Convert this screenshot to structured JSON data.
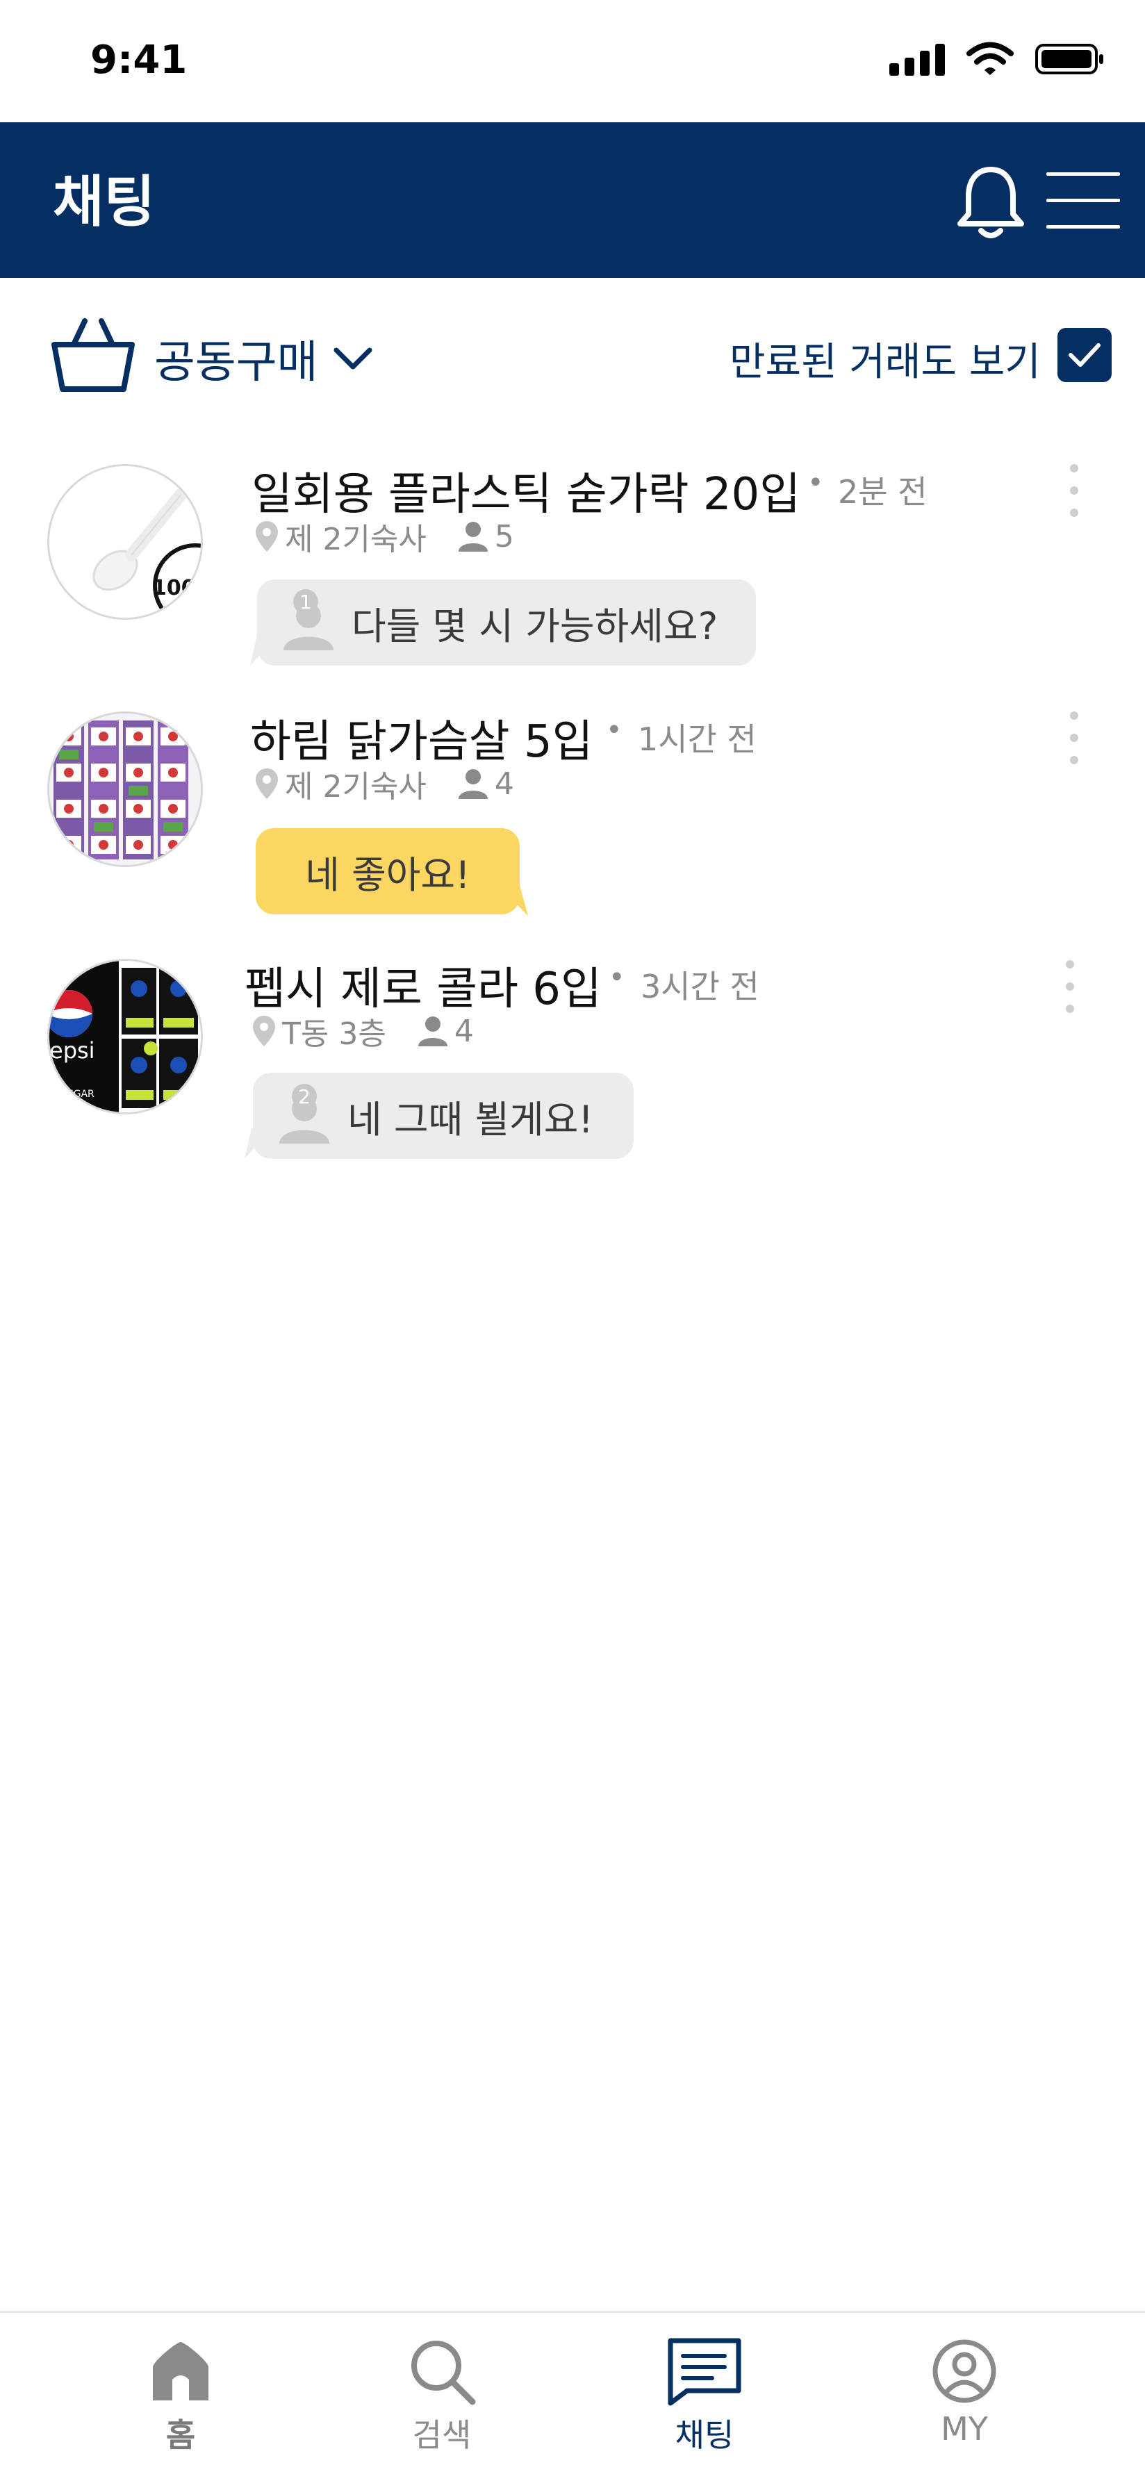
{
  "status_bar": {
    "time": "9:41"
  },
  "header": {
    "title": "채팅"
  },
  "filter": {
    "category": "공동구매",
    "show_expired_label": "만료된 거래도 보기",
    "show_expired_checked": true
  },
  "chats": [
    {
      "title": "일회용 플라스틱 숟가락 20입",
      "time": "2분 전",
      "location": "제 2기숙사",
      "members": "5",
      "message": "다들 몇 시 가능하세요?",
      "sender_badge": "1",
      "bubble": "gray"
    },
    {
      "title": "하림 닭가슴살 5입",
      "time": "1시간 전",
      "location": "제 2기숙사",
      "members": "4",
      "message": "네 좋아요!",
      "bubble": "yellow"
    },
    {
      "title": "펩시 제로 콜라 6입",
      "time": "3시간 전",
      "location": "T동 3층",
      "members": "4",
      "message": "네 그때 뵐게요!",
      "sender_badge": "2",
      "bubble": "gray"
    }
  ],
  "bottom_nav": [
    {
      "label": "홈",
      "icon": "home-icon",
      "active": false
    },
    {
      "label": "검색",
      "icon": "search-icon",
      "active": false
    },
    {
      "label": "채팅",
      "icon": "chat-icon",
      "active": true
    },
    {
      "label": "MY",
      "icon": "profile-icon",
      "active": false
    }
  ],
  "colors": {
    "primary": "#052e63",
    "bubble_gray": "#ececec",
    "bubble_yellow": "#fcd662",
    "muted": "#8a8a8a"
  }
}
